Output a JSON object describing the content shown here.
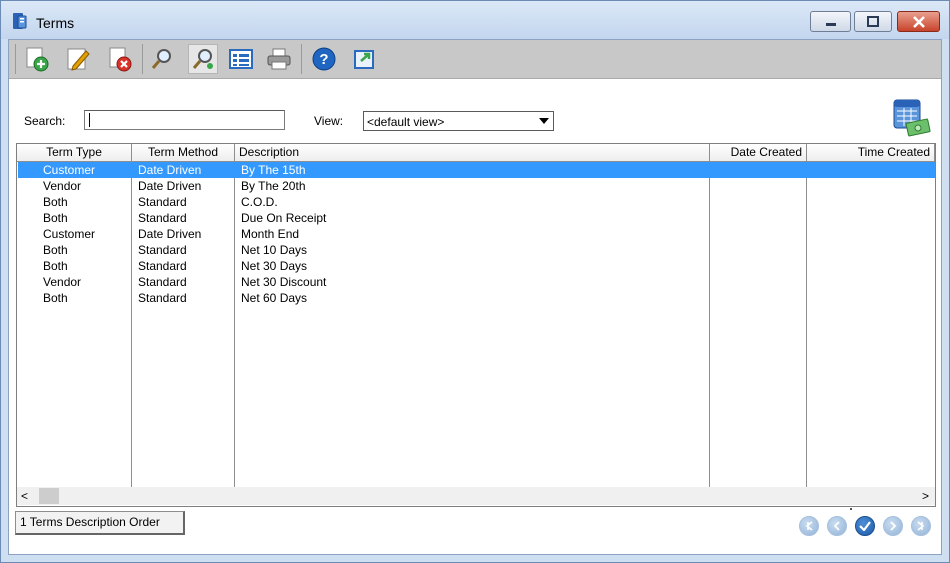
{
  "window": {
    "title": "Terms"
  },
  "toolbar": {
    "buttons": [
      {
        "name": "add-icon",
        "color": "#3aa64a"
      },
      {
        "name": "edit-icon",
        "color": "#e0a000"
      },
      {
        "name": "delete-icon",
        "color": "#d9332a"
      },
      {
        "name": "find-icon",
        "color": "#555555"
      },
      {
        "name": "find-next-icon",
        "color": "#555555"
      },
      {
        "name": "list-icon",
        "color": "#2a6bc0"
      },
      {
        "name": "print-icon",
        "color": "#666666"
      },
      {
        "name": "help-icon",
        "color": "#1f66c2"
      },
      {
        "name": "export-icon",
        "color": "#2a6bc0"
      }
    ]
  },
  "search": {
    "label": "Search:",
    "value": ""
  },
  "view": {
    "label": "View:",
    "selected": "<default view>"
  },
  "table": {
    "columns": [
      "Term Type",
      "Term Method",
      "Description",
      "Date Created",
      "Time Created"
    ],
    "rows": [
      {
        "term_type": "Customer",
        "term_method": "Date Driven",
        "description": "By The 15th",
        "date_created": "",
        "time_created": ""
      },
      {
        "term_type": "Vendor",
        "term_method": "Date Driven",
        "description": "By The 20th",
        "date_created": "",
        "time_created": ""
      },
      {
        "term_type": "Both",
        "term_method": "Standard",
        "description": "C.O.D.",
        "date_created": "",
        "time_created": ""
      },
      {
        "term_type": "Both",
        "term_method": "Standard",
        "description": "Due On Receipt",
        "date_created": "",
        "time_created": ""
      },
      {
        "term_type": "Customer",
        "term_method": "Date Driven",
        "description": "Month End",
        "date_created": "",
        "time_created": ""
      },
      {
        "term_type": "Both",
        "term_method": "Standard",
        "description": "Net 10 Days",
        "date_created": "",
        "time_created": ""
      },
      {
        "term_type": "Both",
        "term_method": "Standard",
        "description": "Net 30 Days",
        "date_created": "",
        "time_created": ""
      },
      {
        "term_type": "Vendor",
        "term_method": "Standard",
        "description": "Net 30 Discount",
        "date_created": "",
        "time_created": ""
      },
      {
        "term_type": "Both",
        "term_method": "Standard",
        "description": "Net 60 Days",
        "date_created": "",
        "time_created": ""
      }
    ],
    "selected_row": 0
  },
  "order_tab": {
    "label": "1 Terms Description Order"
  },
  "navigation": [
    "first-record-icon",
    "previous-record-icon",
    "confirm-icon",
    "next-record-icon",
    "last-record-icon"
  ],
  "colors": {
    "selection": "#3399ff",
    "accent": "#1f66c2",
    "toolbar_bg": "#c8c8c8"
  }
}
